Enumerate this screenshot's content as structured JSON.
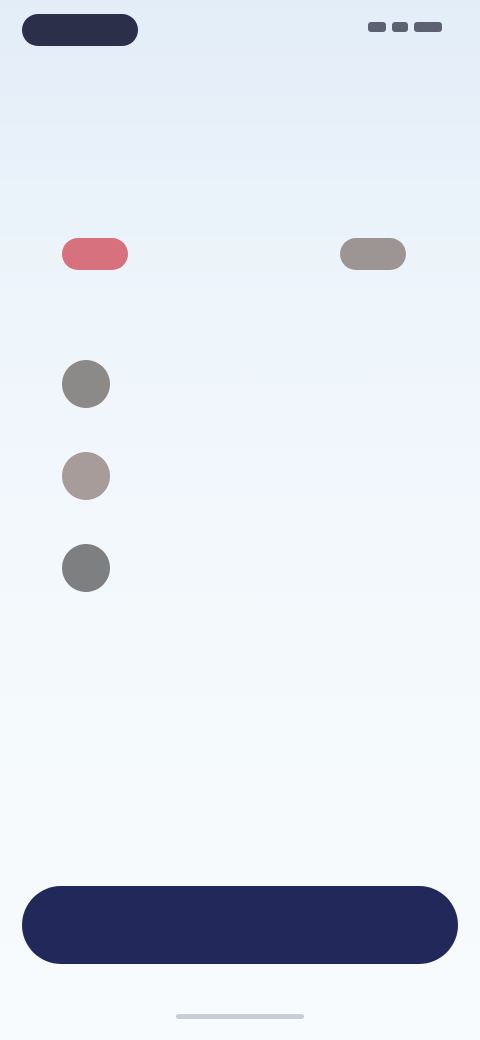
{
  "status_bar": {
    "time": "",
    "icons": [
      "signal-icon",
      "wifi-icon",
      "battery-icon"
    ]
  },
  "question": {
    "title": ""
  },
  "match": {
    "home_team": {
      "name": "",
      "color": "#d7717e"
    },
    "away_team": {
      "name": "",
      "color": "#9d9594"
    }
  },
  "section_links": {
    "left": "",
    "right": ""
  },
  "players": [
    {
      "name": "",
      "detail": ""
    },
    {
      "name": "",
      "detail": ""
    },
    {
      "name": "",
      "detail": ""
    }
  ],
  "caption": "",
  "subheading": "",
  "sub_links": [
    "",
    ""
  ],
  "terms": "",
  "cta": {
    "label": "",
    "color": "#23285a"
  }
}
